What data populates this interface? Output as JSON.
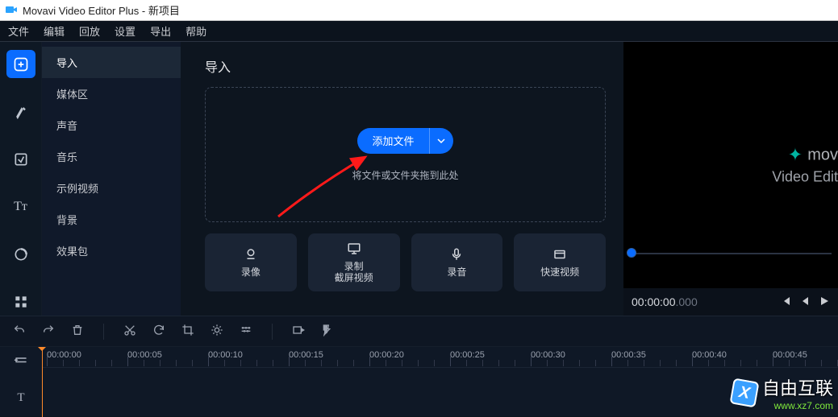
{
  "window": {
    "title": "Movavi Video Editor Plus - 新项目"
  },
  "menubar": [
    "文件",
    "编辑",
    "回放",
    "设置",
    "导出",
    "帮助"
  ],
  "toolrail": [
    {
      "name": "import-tool",
      "active": true
    },
    {
      "name": "effects-tool",
      "active": false
    },
    {
      "name": "transitions-tool",
      "active": false
    },
    {
      "name": "titles-tool",
      "active": false
    },
    {
      "name": "stickers-tool",
      "active": false
    },
    {
      "name": "more-tool",
      "active": false
    }
  ],
  "sidebar": {
    "items": [
      {
        "label": "导入",
        "active": true
      },
      {
        "label": "媒体区",
        "active": false
      },
      {
        "label": "声音",
        "active": false
      },
      {
        "label": "音乐",
        "active": false
      },
      {
        "label": "示例视频",
        "active": false
      },
      {
        "label": "背景",
        "active": false
      },
      {
        "label": "效果包",
        "active": false
      }
    ]
  },
  "center": {
    "title": "导入",
    "addfile_label": "添加文件",
    "drop_hint": "将文件或文件夹拖到此处",
    "cards": [
      {
        "name": "record-camera",
        "label": "录像"
      },
      {
        "name": "record-screen",
        "label": "录制\n截屏视频"
      },
      {
        "name": "record-audio",
        "label": "录音"
      },
      {
        "name": "quick-video",
        "label": "快速视频"
      }
    ]
  },
  "preview": {
    "brand_prefix": "mov",
    "brand_line2": "Video Edit",
    "timecode": "00:00:00",
    "timecode_ms": ".000"
  },
  "ruler": {
    "labels": [
      "00:00:00",
      "00:00:05",
      "00:00:10",
      "00:00:15",
      "00:00:20",
      "00:00:25",
      "00:00:30",
      "00:00:35",
      "00:00:40",
      "00:00:45"
    ]
  },
  "site_watermark": {
    "text": "自由互联",
    "url": "www.xz7.com"
  }
}
